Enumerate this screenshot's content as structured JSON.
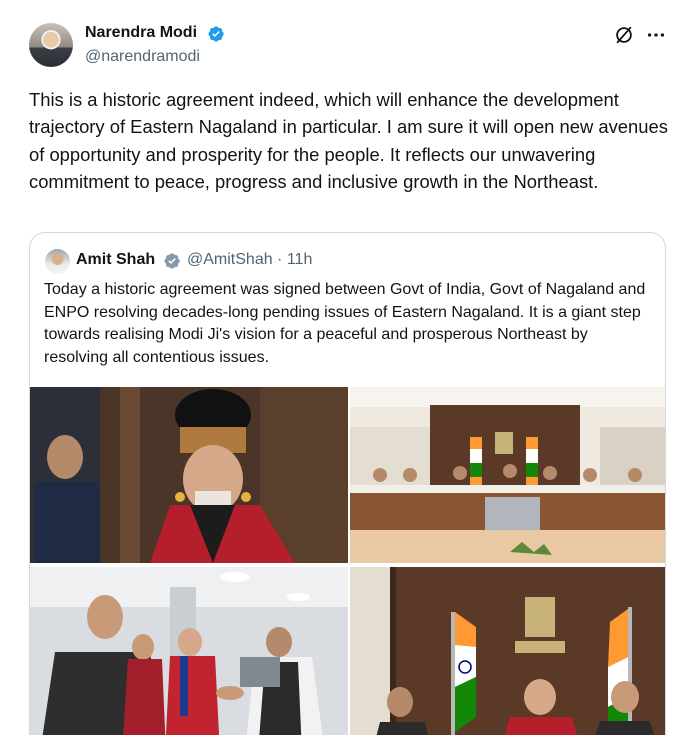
{
  "post": {
    "author_name": "Narendra Modi",
    "author_handle": "@narendramodi",
    "text": "This is a historic agreement indeed, which will enhance the development trajectory of Eastern Nagaland in particular. I am sure it will open new avenues of opportunity and prosperity for the people. It reflects our unwavering commitment to peace, progress and inclusive growth in the Northeast."
  },
  "quote": {
    "author_name": "Amit Shah",
    "author_handle": "@AmitShah · 11h",
    "text": "Today a historic agreement was signed between Govt of India, Govt of Nagaland and ENPO resolving decades-long pending issues of Eastern Nagaland. It is a giant step towards realising Modi Ji's vision for a peaceful and prosperous Northeast by resolving all contentious issues."
  },
  "colors": {
    "verified": "#1d9bf0",
    "secondary_text": "#536471",
    "border": "#cfd9de"
  },
  "icons": {
    "grok": "grok-icon",
    "more": "more-icon"
  }
}
